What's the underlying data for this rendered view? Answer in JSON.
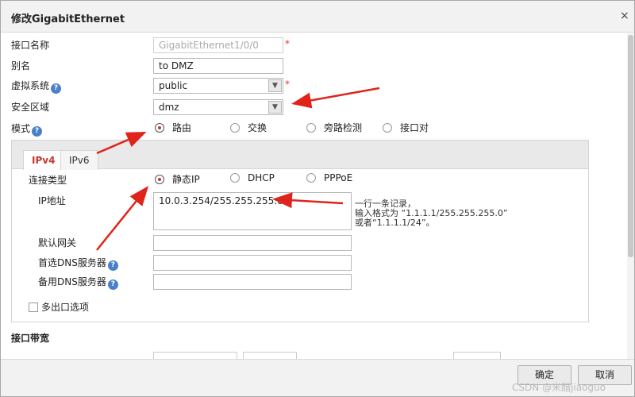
{
  "dialog": {
    "title": "修改GigabitEthernet",
    "close": "×"
  },
  "form": {
    "interface_name": {
      "label": "接口名称",
      "value": "GigabitEthernet1/0/0",
      "required_mark": "*"
    },
    "alias": {
      "label": "别名",
      "value": "to DMZ"
    },
    "virtual_system": {
      "label": "虚拟系统",
      "help": "?",
      "value": "public",
      "required_mark": "*"
    },
    "security_zone": {
      "label": "安全区域",
      "value": "dmz"
    },
    "mode": {
      "label": "模式",
      "help": "?",
      "options": [
        "路由",
        "交换",
        "旁路检测",
        "接口对"
      ],
      "selected": "路由"
    }
  },
  "ip_tabs": {
    "items": [
      "IPv4",
      "IPv6"
    ],
    "active": "IPv4"
  },
  "ipv4": {
    "connection_type": {
      "label": "连接类型",
      "options": [
        "静态IP",
        "DHCP",
        "PPPoE"
      ],
      "selected": "静态IP"
    },
    "ip_address": {
      "label": "IP地址",
      "value": "10.0.3.254/255.255.255.0",
      "hint_lines": [
        "一行一条记录，",
        "输入格式为 “1.1.1.1/255.255.255.0”",
        "或者“1.1.1.1/24”。"
      ]
    },
    "default_gateway": {
      "label": "默认网关",
      "value": ""
    },
    "primary_dns": {
      "label": "首选DNS服务器",
      "help": "?",
      "value": ""
    },
    "secondary_dns": {
      "label": "备用DNS服务器",
      "help": "?",
      "value": ""
    },
    "multi_egress": {
      "label": "多出口选项",
      "checked": false
    }
  },
  "bandwidth": {
    "title": "接口带宽"
  },
  "footer": {
    "ok": "确定",
    "cancel": "取消"
  },
  "watermark": "CSDN @米醋jiaoguo",
  "colors": {
    "accent": "#c0392b",
    "arrow": "#e0241b",
    "help_icon": "#4a7fc9",
    "required": "#e33333"
  }
}
